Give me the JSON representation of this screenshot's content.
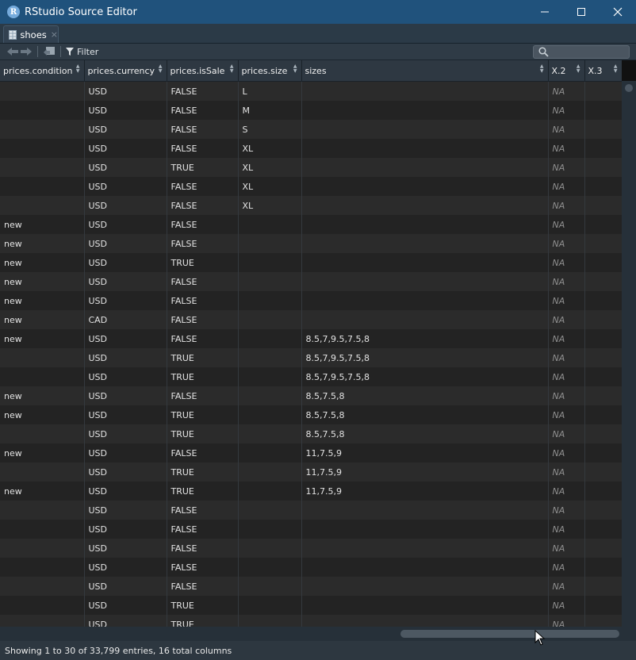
{
  "window": {
    "title": "RStudio Source Editor",
    "logo_letter": "R"
  },
  "tab": {
    "label": "shoes",
    "close": "×"
  },
  "toolbar": {
    "filter_label": "Filter",
    "search_placeholder": ""
  },
  "columns": [
    "prices.condition",
    "prices.currency",
    "prices.isSale",
    "prices.size",
    "sizes",
    "X.2",
    "X.3"
  ],
  "rows": [
    [
      "",
      "USD",
      "FALSE",
      "L",
      "",
      "NA",
      ""
    ],
    [
      "",
      "USD",
      "FALSE",
      "M",
      "",
      "NA",
      ""
    ],
    [
      "",
      "USD",
      "FALSE",
      "S",
      "",
      "NA",
      ""
    ],
    [
      "",
      "USD",
      "FALSE",
      "XL",
      "",
      "NA",
      ""
    ],
    [
      "",
      "USD",
      "TRUE",
      "XL",
      "",
      "NA",
      ""
    ],
    [
      "",
      "USD",
      "FALSE",
      "XL",
      "",
      "NA",
      ""
    ],
    [
      "",
      "USD",
      "FALSE",
      "XL",
      "",
      "NA",
      ""
    ],
    [
      "new",
      "USD",
      "FALSE",
      "",
      "",
      "NA",
      ""
    ],
    [
      "new",
      "USD",
      "FALSE",
      "",
      "",
      "NA",
      ""
    ],
    [
      "new",
      "USD",
      "TRUE",
      "",
      "",
      "NA",
      ""
    ],
    [
      "new",
      "USD",
      "FALSE",
      "",
      "",
      "NA",
      ""
    ],
    [
      "new",
      "USD",
      "FALSE",
      "",
      "",
      "NA",
      ""
    ],
    [
      "new",
      "CAD",
      "FALSE",
      "",
      "",
      "NA",
      ""
    ],
    [
      "new",
      "USD",
      "FALSE",
      "",
      "8.5,7,9.5,7.5,8",
      "NA",
      ""
    ],
    [
      "",
      "USD",
      "TRUE",
      "",
      "8.5,7,9.5,7.5,8",
      "NA",
      ""
    ],
    [
      "",
      "USD",
      "TRUE",
      "",
      "8.5,7,9.5,7.5,8",
      "NA",
      ""
    ],
    [
      "new",
      "USD",
      "FALSE",
      "",
      "8.5,7.5,8",
      "NA",
      ""
    ],
    [
      "new",
      "USD",
      "TRUE",
      "",
      "8.5,7.5,8",
      "NA",
      ""
    ],
    [
      "",
      "USD",
      "TRUE",
      "",
      "8.5,7.5,8",
      "NA",
      ""
    ],
    [
      "new",
      "USD",
      "FALSE",
      "",
      "11,7.5,9",
      "NA",
      ""
    ],
    [
      "",
      "USD",
      "TRUE",
      "",
      "11,7.5,9",
      "NA",
      ""
    ],
    [
      "new",
      "USD",
      "TRUE",
      "",
      "11,7.5,9",
      "NA",
      ""
    ],
    [
      "",
      "USD",
      "FALSE",
      "",
      "",
      "NA",
      ""
    ],
    [
      "",
      "USD",
      "FALSE",
      "",
      "",
      "NA",
      ""
    ],
    [
      "",
      "USD",
      "FALSE",
      "",
      "",
      "NA",
      ""
    ],
    [
      "",
      "USD",
      "FALSE",
      "",
      "",
      "NA",
      ""
    ],
    [
      "",
      "USD",
      "FALSE",
      "",
      "",
      "NA",
      ""
    ],
    [
      "",
      "USD",
      "TRUE",
      "",
      "",
      "NA",
      ""
    ],
    [
      "",
      "USD",
      "TRUE",
      "",
      "",
      "NA",
      ""
    ]
  ],
  "status": {
    "text": "Showing 1 to 30 of 33,799 entries, 16 total columns"
  },
  "colors": {
    "titlebar": "#20527c",
    "header": "#2e3842",
    "row_odd": "#2b2b2b",
    "row_even": "#232323",
    "na_text": "#8e8e8e"
  }
}
